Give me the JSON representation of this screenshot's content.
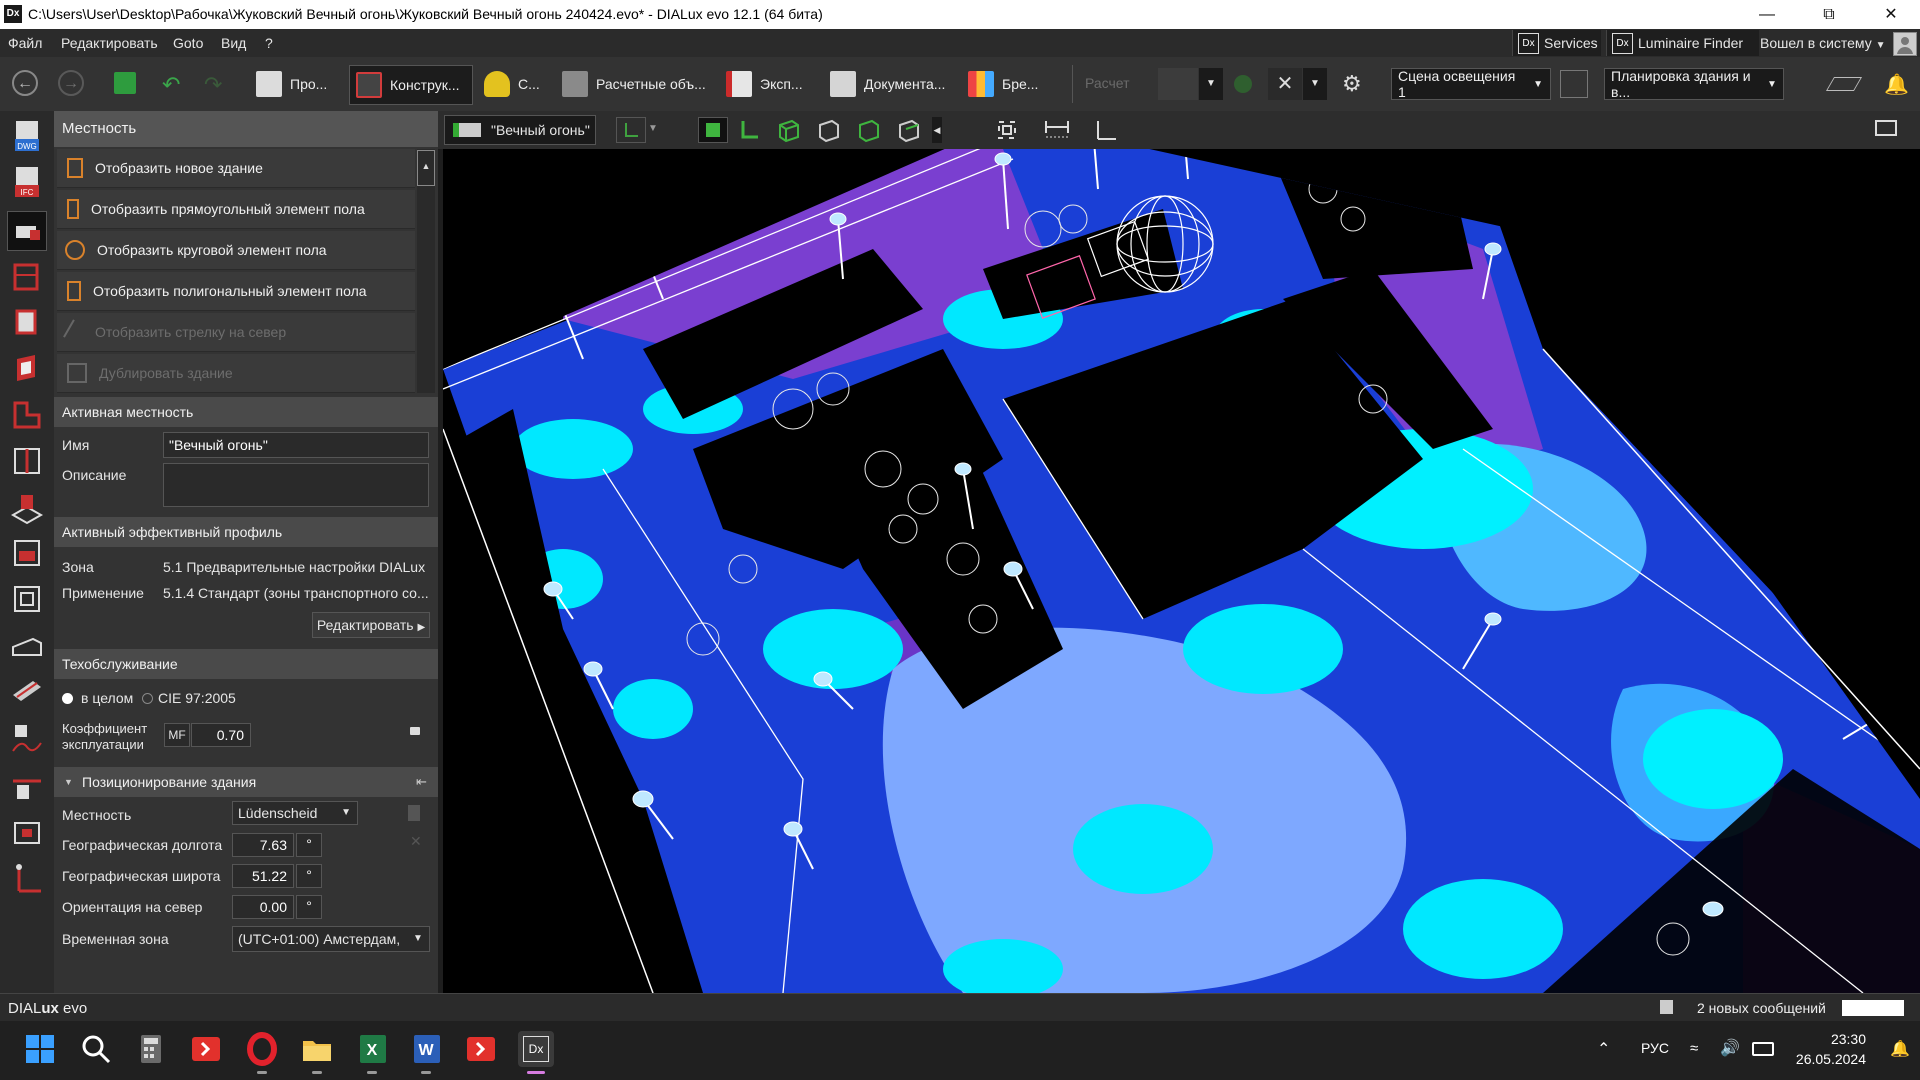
{
  "window": {
    "app_icon": "Dx",
    "title": "C:\\Users\\User\\Desktop\\Рабочка\\Жуковский Вечный огонь\\Жуковский Вечный огонь 240424.evo* - DIALux evo 12.1  (64 бита)",
    "controls": [
      "minimize-icon",
      "maximize-icon",
      "close-icon"
    ]
  },
  "menubar": {
    "items": [
      "Файл",
      "Редактировать",
      "Goto",
      "Вид",
      "?"
    ],
    "services": "Services",
    "luminaire_finder": "Luminaire Finder",
    "login": "Вошел в систему",
    "dx": "Dx"
  },
  "toolbar": {
    "tabs": [
      "Про...",
      "Конструк...",
      "С...",
      "Расчетные объ...",
      "Эксп...",
      "Документа...",
      "Бре..."
    ],
    "calc_label": "Расчет",
    "scene": "Сцена освещения 1",
    "layout": "Планировка здания и в..."
  },
  "viewport": {
    "scene_name": "\"Вечный огонь\""
  },
  "panel": {
    "header": "Местность",
    "actions": [
      {
        "label": "Отобразить новое здание",
        "enabled": true
      },
      {
        "label": "Отобразить прямоугольный элемент пола",
        "enabled": true
      },
      {
        "label": "Отобразить круговой элемент пола",
        "enabled": true
      },
      {
        "label": "Отобразить полигональный элемент пола",
        "enabled": true
      },
      {
        "label": "Отобразить стрелку на север",
        "enabled": false
      },
      {
        "label": "Дублировать здание",
        "enabled": false
      }
    ],
    "active_site": {
      "header": "Активная местность",
      "name_label": "Имя",
      "name_value": "\"Вечный огонь\"",
      "desc_label": "Описание",
      "desc_value": ""
    },
    "profile": {
      "header": "Активный эффективный профиль",
      "zone_label": "Зона",
      "zone_value": "5.1 Предварительные настройки DIALux",
      "use_label": "Применение",
      "use_value": "5.1.4 Стандарт (зоны транспортного со...",
      "edit_button": "Редактировать"
    },
    "maintenance": {
      "header": "Техобслуживание",
      "opt_total": "в целом",
      "opt_cie": "CIE 97:2005",
      "factor_label_1": "Коэффициент",
      "factor_label_2": "эксплуатации",
      "mf": "MF",
      "mf_value": "0.70"
    },
    "positioning": {
      "header": "Позиционирование здания",
      "site_label": "Местность",
      "site_value": "Lüdenscheid",
      "lon_label": "Географическая долгота",
      "lon_value": "7.63",
      "lat_label": "Географическая широта",
      "lat_value": "51.22",
      "north_label": "Ориентация на север",
      "north_value": "0.00",
      "deg": "°",
      "tz_label": "Временная зона",
      "tz_value": "(UTC+01:00) Амстердам,"
    }
  },
  "statusbar": {
    "brand_dia": "DIAL",
    "brand_ux": "ux",
    "brand_evo": " evo",
    "messages": "2 новых сообщений"
  },
  "taskbar": {
    "lang": "РУС",
    "time": "23:30",
    "date": "26.05.2024",
    "dx": "Dx"
  }
}
